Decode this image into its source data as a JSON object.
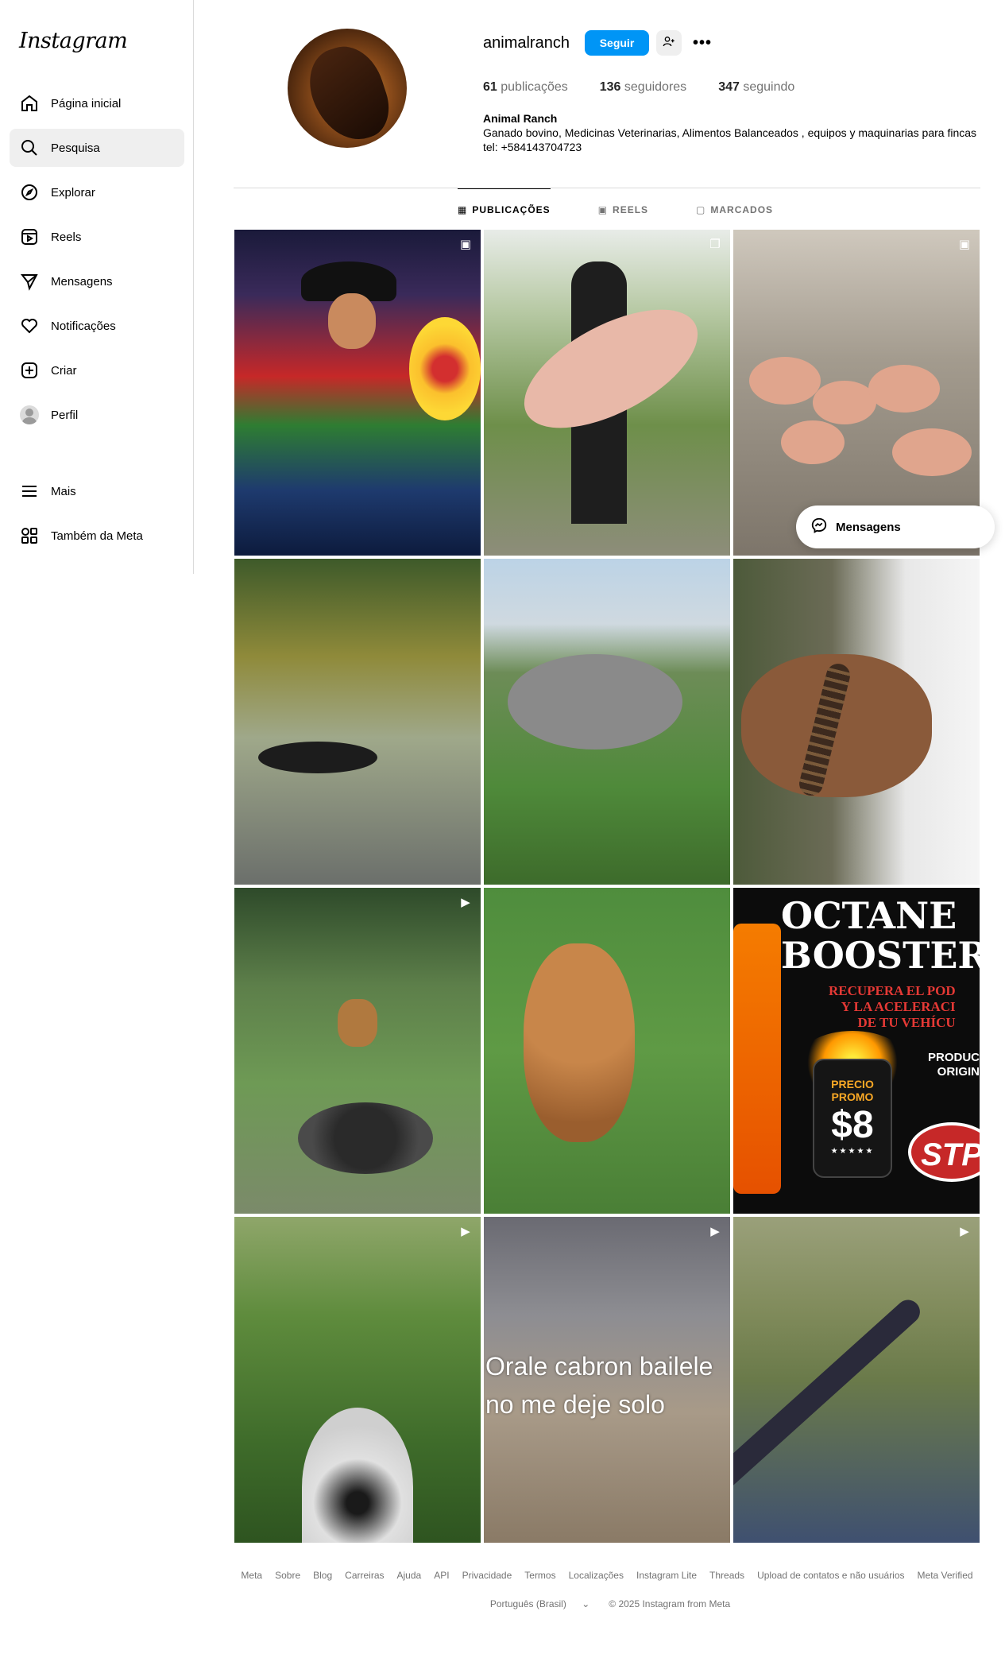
{
  "sidebar": {
    "logo": "Instagram",
    "items": [
      {
        "label": "Página inicial",
        "icon": "home-icon"
      },
      {
        "label": "Pesquisa",
        "icon": "search-icon"
      },
      {
        "label": "Explorar",
        "icon": "compass-icon"
      },
      {
        "label": "Reels",
        "icon": "reels-icon"
      },
      {
        "label": "Mensagens",
        "icon": "send-icon"
      },
      {
        "label": "Notificações",
        "icon": "heart-icon"
      },
      {
        "label": "Criar",
        "icon": "plus-square-icon"
      },
      {
        "label": "Perfil",
        "icon": "avatar"
      }
    ],
    "more": "Mais",
    "meta": "Também da Meta"
  },
  "profile": {
    "username": "animalranch",
    "follow_label": "Seguir",
    "more_glyph": "•••",
    "posts": "61",
    "posts_label": "publicações",
    "followers": "136",
    "followers_label": "seguidores",
    "following": "347",
    "following_label": "seguindo",
    "name": "Animal Ranch",
    "bio_line1": "Ganado bovino, Medicinas Veterinarias, Alimentos Balanceados , equipos y maquinarias para fincas",
    "bio_line2": "tel: +584143704723"
  },
  "tabs": [
    {
      "label": "PUBLICAÇÕES",
      "active": true
    },
    {
      "label": "REELS",
      "active": false
    },
    {
      "label": "MARCADOS",
      "active": false
    }
  ],
  "posts": {
    "p9": {
      "title1": "OCTANE",
      "title2": "BOOSTER",
      "red1": "RECUPERA EL POD",
      "red2": "Y LA ACELERACI",
      "red3": "DE TU VEHÍCU",
      "prod1": "PRODUC",
      "prod2": "ORIGIN",
      "tag1": "PRECIO PROMO",
      "tag2": "$8",
      "tag3": "★★★★★",
      "brand": "STP"
    },
    "p11": {
      "line1": "Orale cabron bailele",
      "line2": "no me deje solo"
    }
  },
  "floating": {
    "messages": "Mensagens"
  },
  "footer": {
    "links": [
      "Meta",
      "Sobre",
      "Blog",
      "Carreiras",
      "Ajuda",
      "API",
      "Privacidade",
      "Termos",
      "Localizações",
      "Instagram Lite",
      "Threads",
      "Upload de contatos e não usuários",
      "Meta Verified"
    ],
    "language": "Português (Brasil)",
    "copyright": "© 2025 Instagram from Meta"
  },
  "colors": {
    "accent": "#0095f6",
    "border": "#dbdbdb",
    "muted": "#737373"
  }
}
